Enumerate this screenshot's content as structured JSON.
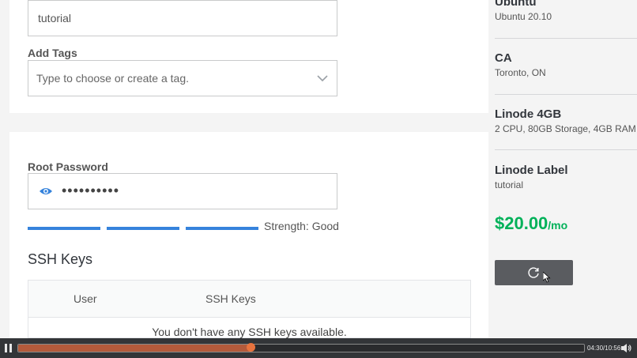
{
  "form": {
    "label_value": "tutorial",
    "add_tags_label": "Add Tags",
    "tags_placeholder": "Type to choose or create a tag.",
    "root_password_label": "Root Password",
    "root_password_masked": "••••••••••",
    "strength_text": "Strength: Good",
    "ssh_keys_title": "SSH Keys",
    "ssh_table": {
      "columns": [
        "User",
        "SSH Keys"
      ],
      "empty_message": "You don't have any SSH keys available."
    }
  },
  "summary": {
    "items": [
      {
        "title": "Ubuntu",
        "subtitle": "Ubuntu 20.10"
      },
      {
        "title": "CA",
        "subtitle": "Toronto, ON"
      },
      {
        "title": "Linode 4GB",
        "subtitle": "2 CPU, 80GB Storage, 4GB RAM"
      },
      {
        "title": "Linode Label",
        "subtitle": "tutorial"
      }
    ],
    "price": "$20.00",
    "price_period": "/mo"
  },
  "player": {
    "timecode": "04:30/10:56",
    "progress_fraction": 0.411
  },
  "colors": {
    "accent_blue": "#3683dc",
    "price_green": "#00b159",
    "button_gray": "#5a5c60",
    "progress_orange": "#e8733e"
  },
  "icons": [
    "chevron-down-icon",
    "eye-icon",
    "refresh-spinner-icon",
    "mouse-cursor-icon",
    "pause-icon",
    "volume-icon"
  ]
}
